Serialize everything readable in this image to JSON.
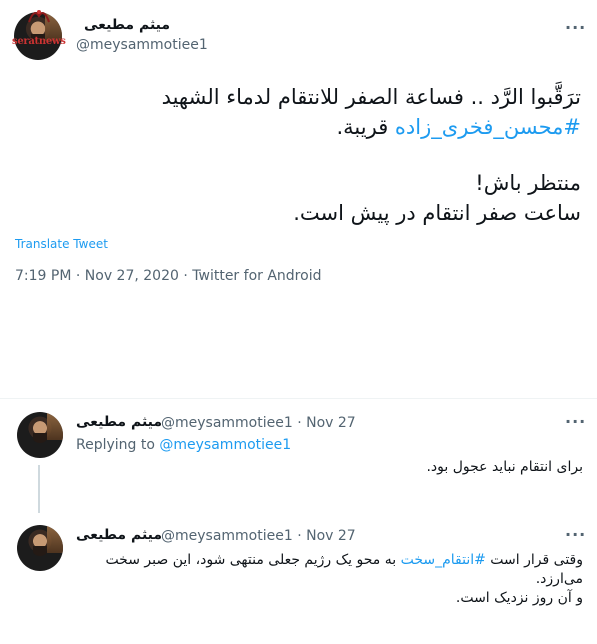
{
  "watermark": {
    "text": "seratnews",
    "logo_label": "صراط"
  },
  "main_tweet": {
    "author_name": "میثم مطیعی",
    "author_handle": "@meysammotiee1",
    "text_line1": "ترَقَّبوا الرَّد .. فساعة الصفر للانتقام لدماء الشهيد",
    "hashtag": "#محسن_فخری_زاده",
    "text_line2_rest": " قريبة.",
    "text_line3": "منتظر باش!",
    "text_line4": "ساعت صفر انتقام در پیش است.",
    "translate_label": "Translate Tweet",
    "time": "7:19 PM",
    "date": "Nov 27, 2020",
    "source": "Twitter for Android",
    "sep": " · "
  },
  "reply1": {
    "author_name": "میثم مطیعی",
    "author_handle": "@meysammotiee1",
    "date": "Nov 27",
    "replying_prefix": "Replying to ",
    "replying_to": "@meysammotiee1",
    "text": "برای انتقام نباید عجول بود."
  },
  "reply2": {
    "author_name": "میثم مطیعی",
    "author_handle": "@meysammotiee1",
    "date": "Nov 27",
    "text_prefix": "وقتی قرار است ",
    "hashtag": "#انتقام_سخت",
    "text_rest": " به محو یک رژیم جعلی منتهی شود، این صبر سخت",
    "text_line2": "می‌ارزد.",
    "text_line3": "و آن روز نزدیک است."
  },
  "colors": {
    "link": "#1d9bf0",
    "muted": "#536471",
    "text": "#0f1419"
  },
  "icons": {
    "more": "more-icon"
  }
}
